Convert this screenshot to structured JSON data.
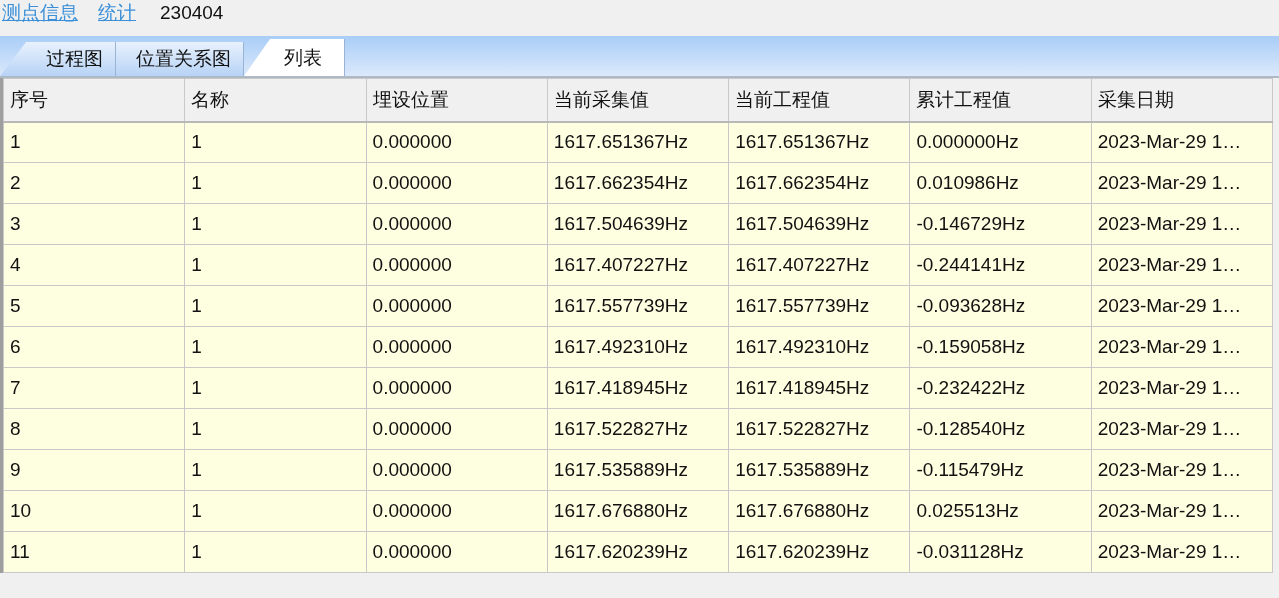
{
  "header": {
    "links": [
      "测点信息",
      "统计"
    ],
    "code": "230404"
  },
  "tabs": [
    {
      "label": "过程图",
      "selected": false
    },
    {
      "label": "位置关系图",
      "selected": false
    },
    {
      "label": "列表",
      "selected": true
    }
  ],
  "table": {
    "columns": [
      "序号",
      "名称",
      "埋设位置",
      "当前采集值",
      "当前工程值",
      "累计工程值",
      "采集日期"
    ],
    "rows": [
      [
        "1",
        "1",
        "0.000000",
        "1617.651367Hz",
        "1617.651367Hz",
        "0.000000Hz",
        "2023-Mar-29 1…"
      ],
      [
        "2",
        "1",
        "0.000000",
        "1617.662354Hz",
        "1617.662354Hz",
        "0.010986Hz",
        "2023-Mar-29 1…"
      ],
      [
        "3",
        "1",
        "0.000000",
        "1617.504639Hz",
        "1617.504639Hz",
        "-0.146729Hz",
        "2023-Mar-29 1…"
      ],
      [
        "4",
        "1",
        "0.000000",
        "1617.407227Hz",
        "1617.407227Hz",
        "-0.244141Hz",
        "2023-Mar-29 1…"
      ],
      [
        "5",
        "1",
        "0.000000",
        "1617.557739Hz",
        "1617.557739Hz",
        "-0.093628Hz",
        "2023-Mar-29 1…"
      ],
      [
        "6",
        "1",
        "0.000000",
        "1617.492310Hz",
        "1617.492310Hz",
        "-0.159058Hz",
        "2023-Mar-29 1…"
      ],
      [
        "7",
        "1",
        "0.000000",
        "1617.418945Hz",
        "1617.418945Hz",
        "-0.232422Hz",
        "2023-Mar-29 1…"
      ],
      [
        "8",
        "1",
        "0.000000",
        "1617.522827Hz",
        "1617.522827Hz",
        "-0.128540Hz",
        "2023-Mar-29 1…"
      ],
      [
        "9",
        "1",
        "0.000000",
        "1617.535889Hz",
        "1617.535889Hz",
        "-0.115479Hz",
        "2023-Mar-29 1…"
      ],
      [
        "10",
        "1",
        "0.000000",
        "1617.676880Hz",
        "1617.676880Hz",
        "0.025513Hz",
        "2023-Mar-29 1…"
      ],
      [
        "11",
        "1",
        "0.000000",
        "1617.620239Hz",
        "1617.620239Hz",
        "-0.031128Hz",
        "2023-Mar-29 1…"
      ]
    ]
  }
}
